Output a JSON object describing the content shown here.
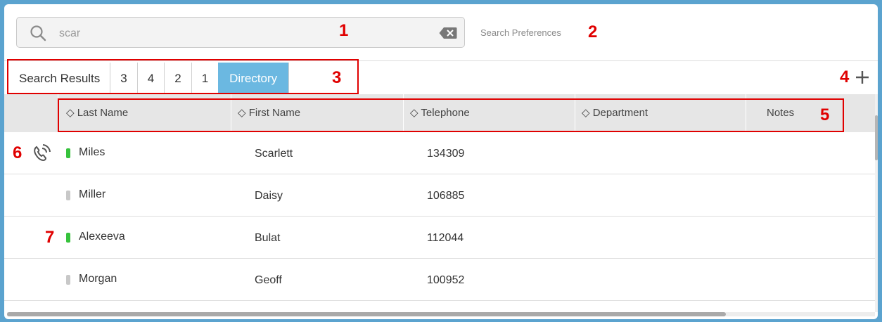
{
  "search": {
    "value": "scar",
    "preferences_label": "Search Preferences"
  },
  "tabs": [
    {
      "label": "Search Results",
      "active": false
    },
    {
      "label": "3",
      "active": false
    },
    {
      "label": "4",
      "active": false
    },
    {
      "label": "2",
      "active": false
    },
    {
      "label": "1",
      "active": false
    },
    {
      "label": "Directory",
      "active": true
    }
  ],
  "columns": {
    "last_name": "◇ Last Name",
    "first_name": "◇ First Name",
    "telephone": "◇ Telephone",
    "department": "◇ Department",
    "notes": "Notes"
  },
  "rows": [
    {
      "last": "Miles",
      "first": "Scarlett",
      "tel": "134309",
      "status": "available",
      "calling": true
    },
    {
      "last": "Miller",
      "first": "Daisy",
      "tel": "106885",
      "status": "offline",
      "calling": false
    },
    {
      "last": "Alexeeva",
      "first": "Bulat",
      "tel": "112044",
      "status": "available",
      "calling": false
    },
    {
      "last": "Morgan",
      "first": "Geoff",
      "tel": "100952",
      "status": "offline",
      "calling": false
    }
  ],
  "annotations": [
    "1",
    "2",
    "3",
    "4",
    "5",
    "6",
    "7"
  ],
  "colors": {
    "accent": "#6bb8e1",
    "frame": "#5ba3cf",
    "status_available": "#36c23c",
    "status_offline": "#c8c8c8",
    "annotation": "#e00000"
  },
  "icons": [
    "search-icon",
    "clear-icon",
    "plus-icon",
    "phone-call-icon"
  ]
}
